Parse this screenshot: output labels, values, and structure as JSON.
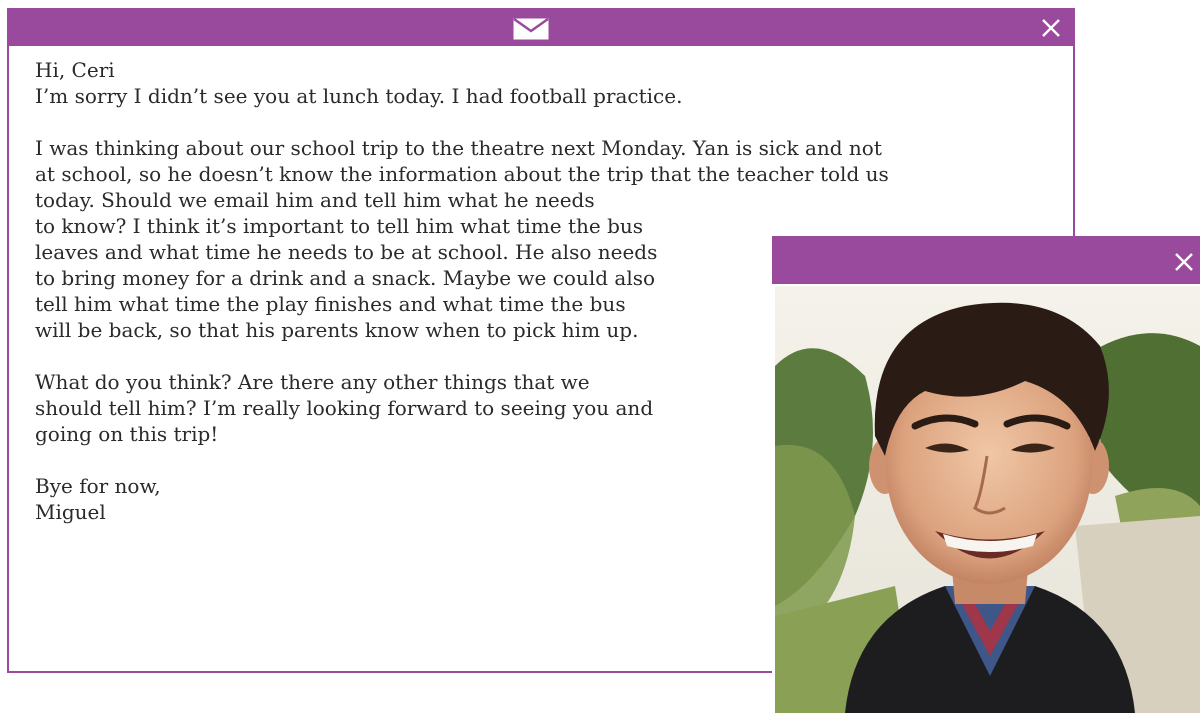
{
  "email": {
    "greeting": "Hi, Ceri",
    "line1": "I’m sorry I didn’t see you at lunch today. I had football practice.",
    "para2_lines": [
      "I was thinking about our school trip to the theatre next Monday. Yan is sick and not",
      "at school, so he doesn’t know the information about the trip that the teacher told us",
      "today. Should we email him and tell him what he needs",
      "to know? I think it’s important to tell him what time the bus",
      "leaves and what time he needs to be at school. He also needs",
      "to bring money for a drink and a snack. Maybe we could also",
      "tell him what time the play finishes and what time the bus",
      "will be back, so that his parents know when to pick him up."
    ],
    "para3_lines": [
      "What do you think? Are there any other things that we",
      "should tell him? I’m really looking forward to seeing you and",
      "going on this trip!"
    ],
    "signoff": "Bye for now,",
    "signature": "Miguel"
  },
  "colors": {
    "accent": "#9a4a9d",
    "text": "#2a2a2a"
  },
  "icons": {
    "email_titlebar": "envelope-icon",
    "close": "close-icon"
  }
}
